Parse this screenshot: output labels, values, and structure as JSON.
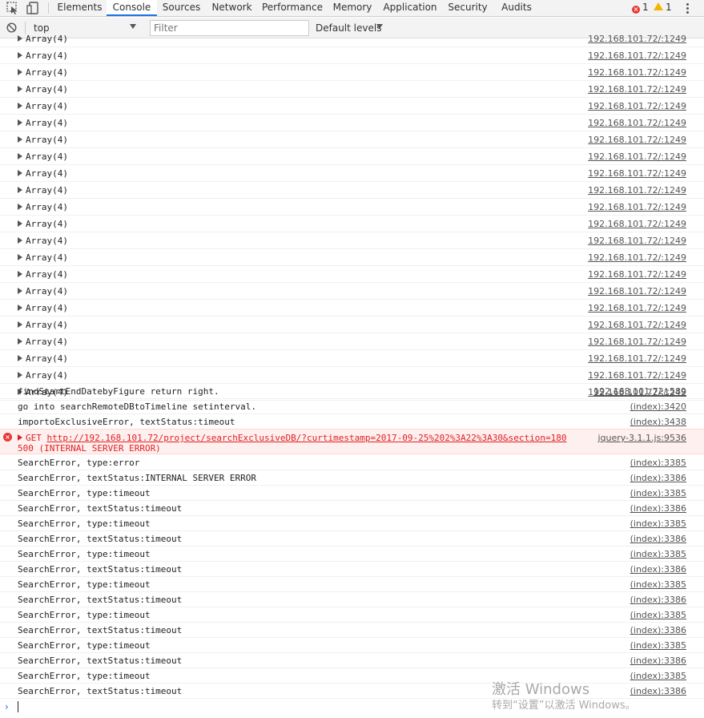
{
  "tabs": [
    "Elements",
    "Console",
    "Sources",
    "Network",
    "Performance",
    "Memory",
    "Application",
    "Security",
    "Audits"
  ],
  "active_tab": "Console",
  "counters": {
    "errors": "1",
    "warnings": "1"
  },
  "toolbar": {
    "context": "top",
    "filter_placeholder": "Filter",
    "levels": "Default levels"
  },
  "array_rows": {
    "label": "Array(4)",
    "source": "192.168.101.72/:1249",
    "count": 21
  },
  "log_rows": [
    {
      "msg": "findStartEndDatebyFigure return right.",
      "src": "192.168.101.72/:589"
    },
    {
      "msg": "go into searchRemoteDBtoTimeline setinterval.",
      "src": "(index):3420"
    },
    {
      "msg": "importoExclusiveError, textStatus:timeout",
      "src": "(index):3438"
    }
  ],
  "error_row": {
    "method": "GET",
    "url": "http://192.168.101.72/project/searchExclusiveDB/?curtimestamp=2017-09-25%202%3A22%3A30&section=180",
    "status": "500 (INTERNAL SERVER ERROR)",
    "src": "jquery-3.1.1.js:9536"
  },
  "search_rows": [
    {
      "msg": "SearchError, type:error",
      "src": "(index):3385"
    },
    {
      "msg": "SearchError, textStatus:INTERNAL SERVER ERROR",
      "src": "(index):3386"
    },
    {
      "msg": "SearchError, type:timeout",
      "src": "(index):3385"
    },
    {
      "msg": "SearchError, textStatus:timeout",
      "src": "(index):3386"
    },
    {
      "msg": "SearchError, type:timeout",
      "src": "(index):3385"
    },
    {
      "msg": "SearchError, textStatus:timeout",
      "src": "(index):3386"
    },
    {
      "msg": "SearchError, type:timeout",
      "src": "(index):3385"
    },
    {
      "msg": "SearchError, textStatus:timeout",
      "src": "(index):3386"
    },
    {
      "msg": "SearchError, type:timeout",
      "src": "(index):3385"
    },
    {
      "msg": "SearchError, textStatus:timeout",
      "src": "(index):3386"
    },
    {
      "msg": "SearchError, type:timeout",
      "src": "(index):3385"
    },
    {
      "msg": "SearchError, textStatus:timeout",
      "src": "(index):3386"
    },
    {
      "msg": "SearchError, type:timeout",
      "src": "(index):3385"
    },
    {
      "msg": "SearchError, textStatus:timeout",
      "src": "(index):3386"
    },
    {
      "msg": "SearchError, type:timeout",
      "src": "(index):3385"
    },
    {
      "msg": "SearchError, textStatus:timeout",
      "src": "(index):3386"
    }
  ],
  "prompt_symbol": "›",
  "watermark": {
    "line1": "激活 Windows",
    "line2": "转到“设置”以激活 Windows。"
  },
  "colors": {
    "accent": "#1a73e8",
    "error": "#e02020",
    "error_bg": "#fff0f0"
  }
}
